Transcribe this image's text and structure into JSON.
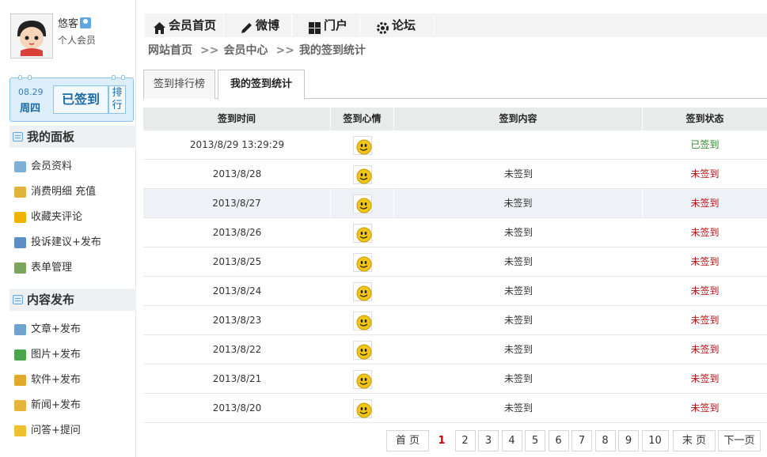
{
  "user": {
    "name": "悠客",
    "role": "个人会员"
  },
  "checkin": {
    "date": "08.29",
    "weekday": "周四",
    "done_label": "已签到",
    "rank_label": "排行"
  },
  "panel": {
    "title": "我的面板",
    "items": [
      {
        "label": "会员资料",
        "icon": "profile-card-icon",
        "color": "#7db0d8"
      },
      {
        "label": "消费明细 充值",
        "icon": "coins-icon",
        "color": "#e0b43a"
      },
      {
        "label": "收藏夹评论",
        "icon": "star-icon",
        "color": "#f0b400"
      },
      {
        "label": "投诉建议+发布",
        "icon": "notebook-icon",
        "color": "#5a8fc7"
      },
      {
        "label": "表单管理",
        "icon": "form-edit-icon",
        "color": "#7aa55a"
      }
    ]
  },
  "publish": {
    "title": "内容发布",
    "items": [
      {
        "label": "文章+发布",
        "icon": "article-edit-icon",
        "color": "#6ea3cf"
      },
      {
        "label": "图片+发布",
        "icon": "image-icon",
        "color": "#4aa64a"
      },
      {
        "label": "软件+发布",
        "icon": "software-box-icon",
        "color": "#e3a72c"
      },
      {
        "label": "新闻+发布",
        "icon": "news-icon",
        "color": "#e8b33c"
      },
      {
        "label": "问答+提问",
        "icon": "chat-bubble-icon",
        "color": "#f0c030"
      }
    ]
  },
  "topnav": [
    {
      "label": "会员首页",
      "icon": "home-icon"
    },
    {
      "label": "微博",
      "icon": "pen-icon"
    },
    {
      "label": "门户",
      "icon": "grid-icon"
    },
    {
      "label": "论坛",
      "icon": "gear-icon"
    }
  ],
  "breadcrumb": {
    "items": [
      "网站首页",
      "会员中心",
      "我的签到统计"
    ],
    "separator": ">>"
  },
  "tabs": [
    {
      "label": "签到排行榜",
      "active": false
    },
    {
      "label": "我的签到统计",
      "active": true
    }
  ],
  "table": {
    "headers": [
      "签到时间",
      "签到心情",
      "签到内容",
      "签到状态"
    ],
    "rows": [
      {
        "time": "2013/8/29 13:29:29",
        "content": "",
        "status": "已签到",
        "ok": true
      },
      {
        "time": "2013/8/28",
        "content": "未签到",
        "status": "未签到",
        "ok": false
      },
      {
        "time": "2013/8/27",
        "content": "未签到",
        "status": "未签到",
        "ok": false
      },
      {
        "time": "2013/8/26",
        "content": "未签到",
        "status": "未签到",
        "ok": false
      },
      {
        "time": "2013/8/25",
        "content": "未签到",
        "status": "未签到",
        "ok": false
      },
      {
        "time": "2013/8/24",
        "content": "未签到",
        "status": "未签到",
        "ok": false
      },
      {
        "time": "2013/8/23",
        "content": "未签到",
        "status": "未签到",
        "ok": false
      },
      {
        "time": "2013/8/22",
        "content": "未签到",
        "status": "未签到",
        "ok": false
      },
      {
        "time": "2013/8/21",
        "content": "未签到",
        "status": "未签到",
        "ok": false
      },
      {
        "time": "2013/8/20",
        "content": "未签到",
        "status": "未签到",
        "ok": false
      }
    ],
    "highlighted_row": 2,
    "mood_icon": "smiley-face-icon"
  },
  "pager": {
    "first": "首 页",
    "pages": [
      "1",
      "2",
      "3",
      "4",
      "5",
      "6",
      "7",
      "8",
      "9",
      "10"
    ],
    "current": "1",
    "last": "末 页",
    "next": "下一页"
  },
  "colors": {
    "status_ok": "#2a8a2a",
    "status_no": "#b51414",
    "accent_blue": "#1e6aa3"
  }
}
